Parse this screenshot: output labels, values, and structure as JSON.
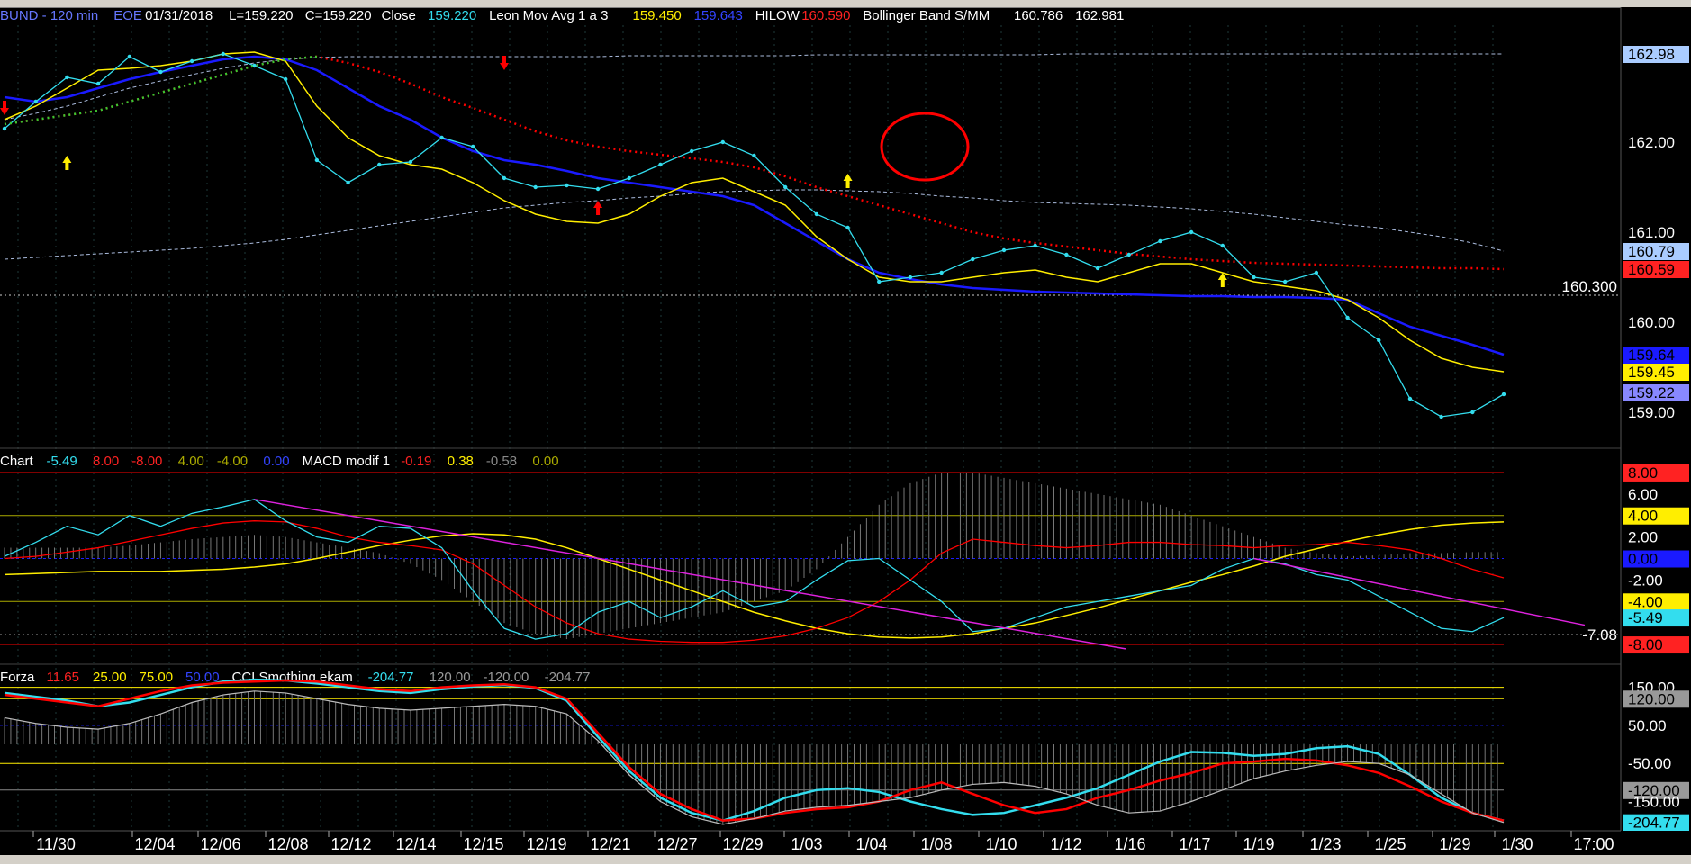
{
  "colors": {
    "bg": "#000000",
    "cyan": "#33ddee",
    "yellow": "#ffee00",
    "blue": "#1a1aff",
    "red": "#ff0000",
    "green": "#33cc33",
    "magenta": "#dd22dd",
    "olive": "#aaaa00",
    "gray": "#999999",
    "dotgray": "#aaaaaa",
    "panelbg": "#000000"
  },
  "toolbar": {
    "icons": [
      "toolbar-icons"
    ]
  },
  "price_panel": {
    "header": [
      {
        "text": "BUND - 120 min",
        "color": "#6677ff"
      },
      {
        "text": "EOE",
        "color": "#6677ff"
      },
      {
        "text": "01/31/2018",
        "color": "#ffffff"
      },
      {
        "text": "L=159.220",
        "color": "#ffffff"
      },
      {
        "text": "C=159.220",
        "color": "#ffffff"
      },
      {
        "text": "Close",
        "color": "#ffffff"
      },
      {
        "text": "159.220",
        "color": "#33ddee"
      },
      {
        "text": "Leon Mov Avg 1 a 3",
        "color": "#ffffff"
      },
      {
        "text": "159.450",
        "color": "#ffee00"
      },
      {
        "text": "159.643",
        "color": "#3344ff"
      },
      {
        "text": "HILOW",
        "color": "#ffffff"
      },
      {
        "text": "160.590",
        "color": "#ff2222"
      },
      {
        "text": "Bollinger Band S/MM",
        "color": "#ffffff"
      },
      {
        "text": "160.786",
        "color": "#ffffff"
      },
      {
        "text": "162.981",
        "color": "#ffffff"
      }
    ],
    "axis_labels": [
      {
        "text": "162.98",
        "value": 162.98,
        "bg": "#aaccff",
        "fg": "#000000"
      },
      {
        "text": "162.00",
        "value": 162.0,
        "bg": "",
        "fg": "#ffffff"
      },
      {
        "text": "161.00",
        "value": 161.0,
        "bg": "",
        "fg": "#ffffff"
      },
      {
        "text": "160.79",
        "value": 160.79,
        "bg": "#aaccff",
        "fg": "#000000"
      },
      {
        "text": "160.59",
        "value": 160.59,
        "bg": "#ff2222",
        "fg": "#000000"
      },
      {
        "text": "160.00",
        "value": 160.0,
        "bg": "",
        "fg": "#ffffff"
      },
      {
        "text": "159.64",
        "value": 159.64,
        "bg": "#1a1aff",
        "fg": "#000000"
      },
      {
        "text": "159.45",
        "value": 159.45,
        "bg": "#ffee00",
        "fg": "#000000"
      },
      {
        "text": "159.22",
        "value": 159.22,
        "bg": "#8888ff",
        "fg": "#000000"
      },
      {
        "text": "159.00",
        "value": 159.0,
        "bg": "",
        "fg": "#ffffff"
      }
    ],
    "hline_label": "160.300",
    "hline_value": 160.3
  },
  "macd_panel": {
    "header": [
      {
        "text": "Chart",
        "color": "#ffffff"
      },
      {
        "text": "-5.49",
        "color": "#33ddee"
      },
      {
        "text": "8.00",
        "color": "#ff2222"
      },
      {
        "text": "-8.00",
        "color": "#ff2222"
      },
      {
        "text": "4.00",
        "color": "#aaaa00"
      },
      {
        "text": "-4.00",
        "color": "#aaaa00"
      },
      {
        "text": "0.00",
        "color": "#3344ff"
      },
      {
        "text": "MACD modif 1",
        "color": "#ffffff"
      },
      {
        "text": "-0.19",
        "color": "#ff2222"
      },
      {
        "text": "0.38",
        "color": "#ffee00"
      },
      {
        "text": "-0.58",
        "color": "#888888"
      },
      {
        "text": "0.00",
        "color": "#aaaa00"
      }
    ],
    "axis_labels": [
      {
        "text": "8.00",
        "value": 8,
        "bg": "#ff2222",
        "fg": "#000000"
      },
      {
        "text": "6.00",
        "value": 6,
        "bg": "",
        "fg": "#ffffff"
      },
      {
        "text": "4.00",
        "value": 4,
        "bg": "#ffee00",
        "fg": "#000000"
      },
      {
        "text": "2.00",
        "value": 2,
        "bg": "",
        "fg": "#ffffff"
      },
      {
        "text": "0.00",
        "value": 0,
        "bg": "#1a1aff",
        "fg": "#000000"
      },
      {
        "text": "-2.00",
        "value": -2,
        "bg": "",
        "fg": "#ffffff"
      },
      {
        "text": "-4.00",
        "value": -4,
        "bg": "#ffee00",
        "fg": "#000000"
      },
      {
        "text": "-5.49",
        "value": -5.49,
        "bg": "#33ddee",
        "fg": "#000000"
      },
      {
        "text": "-8.00",
        "value": -8,
        "bg": "#ff2222",
        "fg": "#000000"
      }
    ],
    "hline_label": "-7.08",
    "hline_value": -7.08
  },
  "cci_panel": {
    "header": [
      {
        "text": "Forza",
        "color": "#ffffff"
      },
      {
        "text": "11.65",
        "color": "#ff2222"
      },
      {
        "text": "25.00",
        "color": "#ffee00"
      },
      {
        "text": "75.00",
        "color": "#ffee00"
      },
      {
        "text": "50.00",
        "color": "#3344ff"
      },
      {
        "text": "CCI Smothing ekam",
        "color": "#ffffff"
      },
      {
        "text": "-204.77",
        "color": "#33ddee"
      },
      {
        "text": "120.00",
        "color": "#999999"
      },
      {
        "text": "-120.00",
        "color": "#999999"
      },
      {
        "text": "-204.77",
        "color": "#999999"
      }
    ],
    "axis_labels": [
      {
        "text": "150.00",
        "value": 150,
        "bg": "",
        "fg": "#ffffff"
      },
      {
        "text": "120.00",
        "value": 120,
        "bg": "#999999",
        "fg": "#000000"
      },
      {
        "text": "50.00",
        "value": 50,
        "bg": "",
        "fg": "#ffffff"
      },
      {
        "text": "-50.00",
        "value": -50,
        "bg": "",
        "fg": "#ffffff"
      },
      {
        "text": "-120.00",
        "value": -120,
        "bg": "#999999",
        "fg": "#000000"
      },
      {
        "text": "-150.00",
        "value": -150,
        "bg": "",
        "fg": "#ffffff"
      },
      {
        "text": "-204.77",
        "value": -204.77,
        "bg": "#33ddee",
        "fg": "#000000"
      }
    ]
  },
  "chart_data": [
    {
      "type": "line",
      "categories": [
        "11/30",
        "12/04",
        "12/06",
        "12/08",
        "12/12",
        "12/14",
        "12/15",
        "12/19",
        "12/21",
        "12/27",
        "12/29",
        "1/03",
        "1/04",
        "1/08",
        "1/10",
        "1/12",
        "1/16",
        "1/17",
        "1/19",
        "1/23",
        "1/25",
        "1/29",
        "1/30",
        "17:00"
      ],
      "ylim": [
        158.7,
        163.4
      ],
      "series": [
        {
          "name": "Close",
          "values": [
            162.15,
            162.45,
            162.72,
            162.65,
            162.95,
            162.78,
            162.9,
            162.98,
            162.85,
            162.7,
            161.8,
            161.55,
            161.75,
            161.78,
            162.05,
            161.95,
            161.6,
            161.5,
            161.52,
            161.48,
            161.6,
            161.75,
            161.9,
            162.0,
            161.85,
            161.5,
            161.2,
            161.05,
            160.45,
            160.5,
            160.55,
            160.7,
            160.8,
            160.85,
            160.75,
            160.6,
            160.75,
            160.9,
            161.0,
            160.85,
            160.5,
            160.45,
            160.55,
            160.05,
            159.8,
            159.15,
            158.95,
            159.0,
            159.2
          ]
        },
        {
          "name": "Leon Mov Avg 1 a 3",
          "values": [
            162.25,
            162.4,
            162.6,
            162.8,
            162.82,
            162.85,
            162.9,
            162.98,
            163.0,
            162.9,
            162.4,
            162.05,
            161.85,
            161.75,
            161.7,
            161.55,
            161.35,
            161.2,
            161.12,
            161.1,
            161.2,
            161.4,
            161.55,
            161.6,
            161.45,
            161.3,
            160.95,
            160.7,
            160.5,
            160.45,
            160.45,
            160.5,
            160.55,
            160.58,
            160.5,
            160.45,
            160.55,
            160.65,
            160.65,
            160.55,
            160.45,
            160.4,
            160.35,
            160.25,
            160.05,
            159.8,
            159.6,
            159.5,
            159.45
          ]
        },
        {
          "name": "",
          "values": [
            162.5,
            162.45,
            162.5,
            162.6,
            162.7,
            162.78,
            162.85,
            162.92,
            162.95,
            162.92,
            162.8,
            162.6,
            162.4,
            162.25,
            162.05,
            161.9,
            161.8,
            161.75,
            161.68,
            161.6,
            161.55,
            161.5,
            161.45,
            161.4,
            161.3,
            161.1,
            160.9,
            160.7,
            160.55,
            160.48,
            160.42,
            160.38,
            160.36,
            160.34,
            160.33,
            160.32,
            160.31,
            160.3,
            160.29,
            160.29,
            160.28,
            160.28,
            160.27,
            160.25,
            160.1,
            159.95,
            159.85,
            159.75,
            159.64
          ]
        },
        {
          "name": "HILOW",
          "values": [
            162.2,
            162.25,
            162.3,
            162.35,
            162.45,
            162.55,
            162.65,
            162.75,
            162.85,
            162.92,
            162.95,
            162.88,
            162.78,
            162.65,
            162.5,
            162.38,
            162.25,
            162.12,
            162.02,
            161.95,
            161.9,
            161.86,
            161.82,
            161.78,
            161.72,
            161.62,
            161.5,
            161.4,
            161.3,
            161.2,
            161.1,
            161.0,
            160.93,
            160.88,
            160.84,
            160.8,
            160.76,
            160.73,
            160.7,
            160.68,
            160.66,
            160.65,
            160.64,
            160.63,
            160.62,
            160.61,
            160.6,
            160.6,
            160.59
          ]
        },
        {
          "name": "",
          "values": [
            162.25,
            162.32,
            162.4,
            162.5,
            162.6,
            162.68,
            162.75,
            162.82,
            162.88,
            162.92,
            162.94,
            162.95,
            162.95,
            162.95,
            162.95,
            162.95,
            162.95,
            162.95,
            162.95,
            162.95,
            162.96,
            162.96,
            162.96,
            162.96,
            162.96,
            162.96,
            162.97,
            162.97,
            162.97,
            162.97,
            162.97,
            162.97,
            162.97,
            162.97,
            162.98,
            162.98,
            162.98,
            162.98,
            162.98,
            162.98,
            162.98,
            162.98,
            162.98,
            162.98,
            162.98,
            162.98,
            162.98,
            162.98,
            162.98
          ]
        },
        {
          "name": "",
          "values": [
            160.7,
            160.72,
            160.74,
            160.76,
            160.78,
            160.8,
            160.82,
            160.85,
            160.88,
            160.92,
            160.97,
            161.02,
            161.07,
            161.12,
            161.17,
            161.22,
            161.27,
            161.3,
            161.33,
            161.35,
            161.38,
            161.4,
            161.43,
            161.45,
            161.46,
            161.47,
            161.47,
            161.46,
            161.45,
            161.43,
            161.4,
            161.38,
            161.35,
            161.33,
            161.32,
            161.31,
            161.3,
            161.28,
            161.26,
            161.23,
            161.2,
            161.16,
            161.12,
            161.08,
            161.05,
            161.0,
            160.95,
            160.88,
            160.79
          ]
        }
      ]
    },
    {
      "type": "line",
      "ylim": [
        -9,
        9
      ],
      "series": [
        {
          "name": "",
          "values": [
            0.2,
            1.5,
            3.0,
            2.2,
            4.0,
            3.0,
            4.2,
            4.8,
            5.5,
            3.5,
            2.0,
            1.5,
            3.0,
            2.8,
            1.0,
            -3.0,
            -6.5,
            -7.5,
            -7.0,
            -5.0,
            -4.0,
            -5.5,
            -4.5,
            -3.0,
            -4.5,
            -4.0,
            -2.0,
            -0.2,
            0.0,
            -2.0,
            -4.0,
            -6.8,
            -6.5,
            -5.5,
            -4.5,
            -4.0,
            -3.5,
            -3.0,
            -2.5,
            -1.0,
            0.0,
            -0.5,
            -1.5,
            -2.0,
            -3.5,
            -5.0,
            -6.5,
            -6.8,
            -5.5
          ]
        },
        {
          "name": "",
          "values": [
            0.0,
            0.2,
            0.6,
            1.0,
            1.6,
            2.2,
            2.8,
            3.3,
            3.5,
            3.4,
            2.8,
            2.0,
            1.5,
            1.2,
            0.8,
            -0.5,
            -2.5,
            -4.5,
            -6.0,
            -7.0,
            -7.5,
            -7.7,
            -7.8,
            -7.8,
            -7.6,
            -7.2,
            -6.5,
            -5.5,
            -4.0,
            -2.0,
            0.5,
            1.8,
            1.5,
            1.2,
            1.0,
            1.2,
            1.5,
            1.5,
            1.3,
            1.2,
            1.0,
            1.2,
            1.3,
            1.5,
            1.2,
            0.8,
            0.0,
            -1.0,
            -1.8
          ]
        },
        {
          "name": "",
          "values": [
            -1.5,
            -1.4,
            -1.3,
            -1.2,
            -1.2,
            -1.2,
            -1.1,
            -1.0,
            -0.8,
            -0.5,
            0.0,
            0.6,
            1.2,
            1.7,
            2.1,
            2.3,
            2.2,
            1.8,
            1.0,
            0.0,
            -1.0,
            -2.0,
            -3.0,
            -4.0,
            -5.0,
            -5.8,
            -6.5,
            -7.0,
            -7.3,
            -7.4,
            -7.3,
            -7.0,
            -6.5,
            -6.0,
            -5.3,
            -4.6,
            -3.8,
            -3.0,
            -2.2,
            -1.5,
            -0.7,
            0.2,
            0.9,
            1.6,
            2.2,
            2.7,
            3.1,
            3.3,
            3.4
          ]
        },
        {
          "name": "",
          "values": [
            1.0,
            1.0,
            1.0,
            1.0,
            1.2,
            1.5,
            1.8,
            2.0,
            2.2,
            2.0,
            1.5,
            1.0,
            0.5,
            -0.5,
            -2.0,
            -4.0,
            -6.0,
            -7.0,
            -7.5,
            -7.0,
            -6.5,
            -6.0,
            -5.5,
            -5.0,
            -4.0,
            -3.0,
            -1.0,
            2.0,
            5.0,
            7.0,
            8.0,
            8.0,
            7.5,
            7.0,
            6.5,
            6.0,
            5.5,
            5.0,
            4.0,
            3.0,
            2.0,
            1.0,
            0.5,
            0.2,
            0.3,
            0.5,
            0.5,
            0.6,
            0.6
          ]
        }
      ]
    },
    {
      "type": "line",
      "ylim": [
        -215,
        175
      ],
      "series": [
        {
          "name": "",
          "values": [
            130,
            120,
            110,
            100,
            120,
            140,
            155,
            162,
            165,
            168,
            165,
            155,
            145,
            140,
            150,
            155,
            158,
            150,
            120,
            30,
            -60,
            -130,
            -170,
            -200,
            -195,
            -180,
            -170,
            -165,
            -150,
            -120,
            -100,
            -130,
            -160,
            -180,
            -170,
            -140,
            -120,
            -95,
            -75,
            -50,
            -45,
            -38,
            -42,
            -55,
            -75,
            -110,
            -150,
            -180,
            -200
          ]
        },
        {
          "name": "",
          "values": [
            135,
            125,
            115,
            100,
            110,
            130,
            150,
            165,
            170,
            168,
            160,
            150,
            140,
            135,
            145,
            152,
            156,
            148,
            115,
            20,
            -70,
            -140,
            -180,
            -200,
            -175,
            -140,
            -120,
            -115,
            -125,
            -150,
            -170,
            -185,
            -180,
            -160,
            -140,
            -115,
            -80,
            -45,
            -20,
            -22,
            -30,
            -25,
            -10,
            -5,
            -25,
            -80,
            -140,
            -180,
            -200
          ]
        },
        {
          "name": "",
          "values": [
            70,
            55,
            45,
            40,
            55,
            80,
            110,
            130,
            140,
            135,
            120,
            105,
            95,
            90,
            95,
            100,
            105,
            100,
            80,
            10,
            -80,
            -150,
            -190,
            -210,
            -195,
            -175,
            -165,
            -160,
            -150,
            -140,
            -120,
            -105,
            -100,
            -110,
            -130,
            -160,
            -180,
            -175,
            -150,
            -120,
            -90,
            -70,
            -55,
            -45,
            -50,
            -80,
            -130,
            -180,
            -205
          ]
        }
      ]
    }
  ]
}
